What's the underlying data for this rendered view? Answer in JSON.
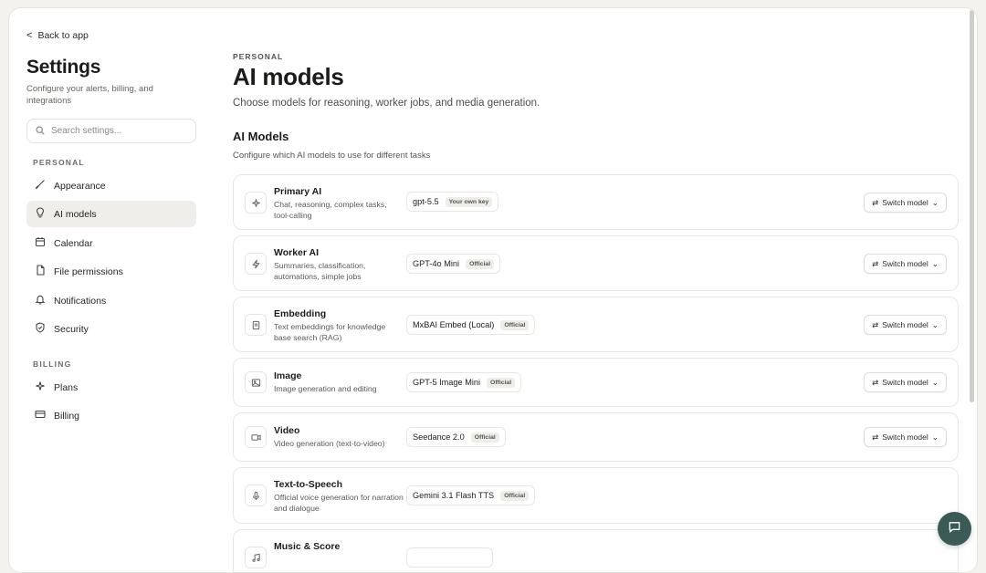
{
  "sidebar": {
    "back_label": "Back to app",
    "title": "Settings",
    "subtitle": "Configure your alerts, billing, and integrations",
    "search_placeholder": "Search settings...",
    "personal_label": "PERSONAL",
    "billing_label": "BILLING",
    "items": [
      {
        "label": "Appearance",
        "icon": "brush-icon"
      },
      {
        "label": "AI models",
        "icon": "bulb-icon",
        "active": true
      },
      {
        "label": "Calendar",
        "icon": "calendar-icon"
      },
      {
        "label": "File permissions",
        "icon": "file-icon"
      },
      {
        "label": "Notifications",
        "icon": "bell-icon"
      },
      {
        "label": "Security",
        "icon": "shield-icon"
      }
    ],
    "billing_items": [
      {
        "label": "Plans",
        "icon": "sparkle-icon"
      },
      {
        "label": "Billing",
        "icon": "card-icon"
      }
    ]
  },
  "main": {
    "breadcrumb": "PERSONAL",
    "title": "AI models",
    "subtitle": "Choose models for reasoning, worker jobs, and media generation.",
    "section_title": "AI Models",
    "section_subtitle": "Configure which AI models to use for different tasks",
    "switch_label": "Switch model",
    "cards": [
      {
        "name": "Primary AI",
        "desc": "Chat, reasoning, complex tasks, tool-calling",
        "model": "gpt-5.5",
        "badge": "Your own key",
        "icon": "sparkle-icon"
      },
      {
        "name": "Worker AI",
        "desc": "Summaries, classification, automations, simple jobs",
        "model": "GPT-4o Mini",
        "badge": "Official",
        "icon": "bolt-icon"
      },
      {
        "name": "Embedding",
        "desc": "Text embeddings for knowledge base search (RAG)",
        "model": "MxBAI Embed (Local)",
        "badge": "Official",
        "icon": "doc-icon"
      },
      {
        "name": "Image",
        "desc": "Image generation and editing",
        "model": "GPT-5 Image Mini",
        "badge": "Official",
        "icon": "image-icon"
      },
      {
        "name": "Video",
        "desc": "Video generation (text-to-video)",
        "model": "Seedance 2.0",
        "badge": "Official",
        "icon": "video-icon"
      },
      {
        "name": "Text-to-Speech",
        "desc": "Official voice generation for narration and dialogue",
        "model": "Gemini 3.1 Flash TTS",
        "badge": "Official",
        "icon": "mic-icon"
      },
      {
        "name": "Music & Score",
        "desc": "",
        "model": "",
        "badge": "",
        "icon": "music-icon"
      }
    ]
  },
  "colors": {
    "accent": "#3a5a55",
    "active_bg": "#efeeea"
  }
}
